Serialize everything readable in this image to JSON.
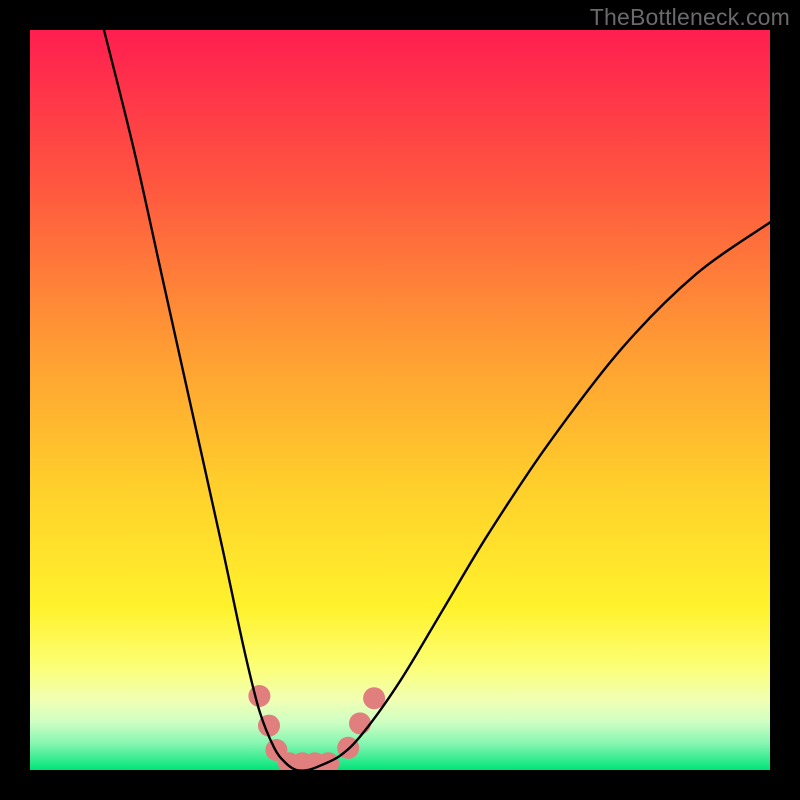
{
  "watermark": "TheBottleneck.com",
  "chart_data": {
    "type": "line",
    "title": "",
    "xlabel": "",
    "ylabel": "",
    "xlim": [
      0,
      100
    ],
    "ylim": [
      0,
      100
    ],
    "background_gradient": {
      "top_color": "#ff1e4f",
      "mid_color": "#ffd52b",
      "bottom_color": "#00e47a",
      "stops": [
        {
          "pos": 0.0,
          "color": "#ff1e50"
        },
        {
          "pos": 0.2,
          "color": "#ff5440"
        },
        {
          "pos": 0.44,
          "color": "#ff9f33"
        },
        {
          "pos": 0.62,
          "color": "#ffd02b"
        },
        {
          "pos": 0.78,
          "color": "#fff22c"
        },
        {
          "pos": 0.86,
          "color": "#fcff75"
        },
        {
          "pos": 0.905,
          "color": "#f1ffb3"
        },
        {
          "pos": 0.935,
          "color": "#cfffc3"
        },
        {
          "pos": 0.965,
          "color": "#84f5b0"
        },
        {
          "pos": 1.0,
          "color": "#00e47a"
        }
      ]
    },
    "series": [
      {
        "name": "bottleneck-curve",
        "stroke": "#000000",
        "x": [
          10,
          14,
          18,
          22,
          26,
          29,
          31,
          33,
          34.5,
          36,
          37.5,
          39,
          42,
          45,
          50,
          56,
          62,
          70,
          80,
          90,
          100
        ],
        "values": [
          100,
          84,
          66,
          48,
          30,
          16,
          8,
          3,
          1,
          0,
          0,
          0.5,
          2,
          5,
          12,
          22,
          32,
          44,
          57,
          67,
          74
        ]
      }
    ],
    "markers": {
      "color": "#e17f7f",
      "radius_px": 11,
      "points": [
        {
          "x": 31.0,
          "y": 10.0
        },
        {
          "x": 32.3,
          "y": 6.0
        },
        {
          "x": 33.3,
          "y": 2.7
        },
        {
          "x": 35.0,
          "y": 0.9
        },
        {
          "x": 36.8,
          "y": 0.9
        },
        {
          "x": 38.5,
          "y": 0.9
        },
        {
          "x": 40.3,
          "y": 0.9
        },
        {
          "x": 43.0,
          "y": 3.0
        },
        {
          "x": 44.6,
          "y": 6.3
        },
        {
          "x": 46.5,
          "y": 9.7
        }
      ]
    }
  }
}
